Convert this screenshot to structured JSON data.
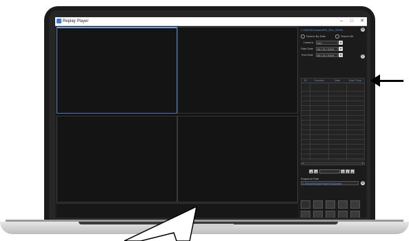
{
  "window": {
    "title": "Replay Player",
    "controls": [
      "–",
      "□",
      "✕"
    ]
  },
  "panel": {
    "path": "C:\\NEDS\\Camera\\Pl4_Rec_20151...",
    "search_by_date_label": "Search By Date",
    "search_all_label": "Search All",
    "camera_label": "Camera",
    "camera_value": "ALL",
    "start_date_label": "Start Date",
    "start_date_value": "06 / 11 / 2015",
    "end_date_label": "End Date",
    "end_date_value": "06 / 11 / 2015",
    "table_headers": [
      "ID",
      "Camera",
      "Date",
      "Start Time"
    ],
    "snapshot_label": "Snapshot Path",
    "snapshot_path": "C:\\Neds\\ReplayPlayer\\Snapshot"
  },
  "colors": {
    "accent": "#4f9ce8",
    "bg": "#1e1e1e"
  },
  "icons": {
    "settings": "gear-icon",
    "pointer": "cursor-arrow-icon",
    "arrow": "arrow-left-icon"
  }
}
